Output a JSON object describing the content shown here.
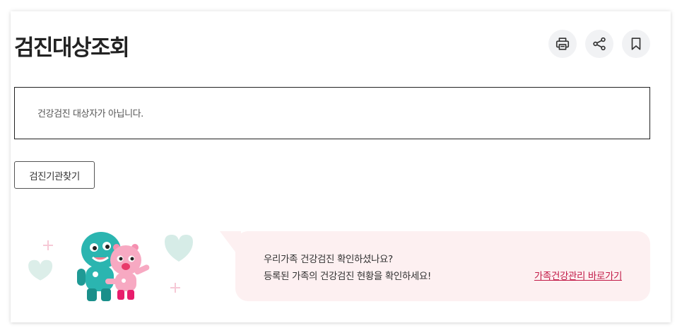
{
  "page": {
    "title": "검진대상조회"
  },
  "toolbar": {
    "icons": [
      "printer-icon",
      "share-icon",
      "bookmark-icon"
    ]
  },
  "notice": {
    "text": "건강검진 대상자가 아닙니다."
  },
  "actions": {
    "find_institution_label": "검진기관찾기"
  },
  "banner": {
    "line1": "우리가족 건강검진 확인하셨나요?",
    "line2": "등록된 가족의 건강검진 현황을 확인하세요!",
    "link_label": "가족건강관리 바로가기"
  },
  "colors": {
    "banner_bg": "#fdf0f1",
    "link": "#c21a47",
    "icon_bg": "#f1f2f4",
    "mascot_teal": "#2bb5b0",
    "mascot_pink": "#f7a9c2"
  }
}
